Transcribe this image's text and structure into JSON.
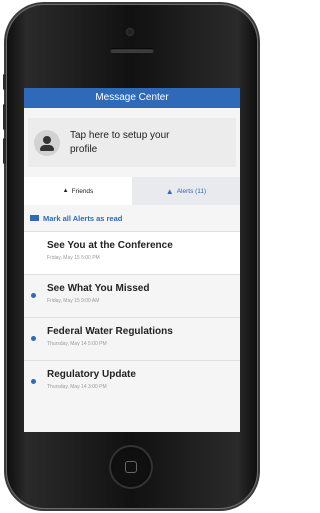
{
  "header": {
    "title": "Message Center"
  },
  "profile": {
    "prompt": "Tap here to setup your profile",
    "prompt_line1": "Tap here to setup your",
    "prompt_line2": "profile"
  },
  "tabs": [
    {
      "label": "Friends",
      "icon": "people-icon"
    },
    {
      "label": "Alerts (11)",
      "icon": "warning-icon"
    }
  ],
  "mark_all": {
    "label": "Mark all Alerts as read"
  },
  "alerts": [
    {
      "title": "See You at the Conference",
      "date": "Friday, May 15 5:00 PM",
      "unread": false
    },
    {
      "title": "See What You Missed",
      "date": "Friday, May 15 9:00 AM",
      "unread": true
    },
    {
      "title": "Federal Water Regulations",
      "date": "Thursday, May 14 5:00 PM",
      "unread": true
    },
    {
      "title": "Regulatory Update",
      "date": "Thursday, May 14 3:00 PM",
      "unread": true
    }
  ],
  "colors": {
    "accent": "#2f6ab9",
    "titlebar": "#2f6ab9",
    "phone_body": "#111111"
  }
}
